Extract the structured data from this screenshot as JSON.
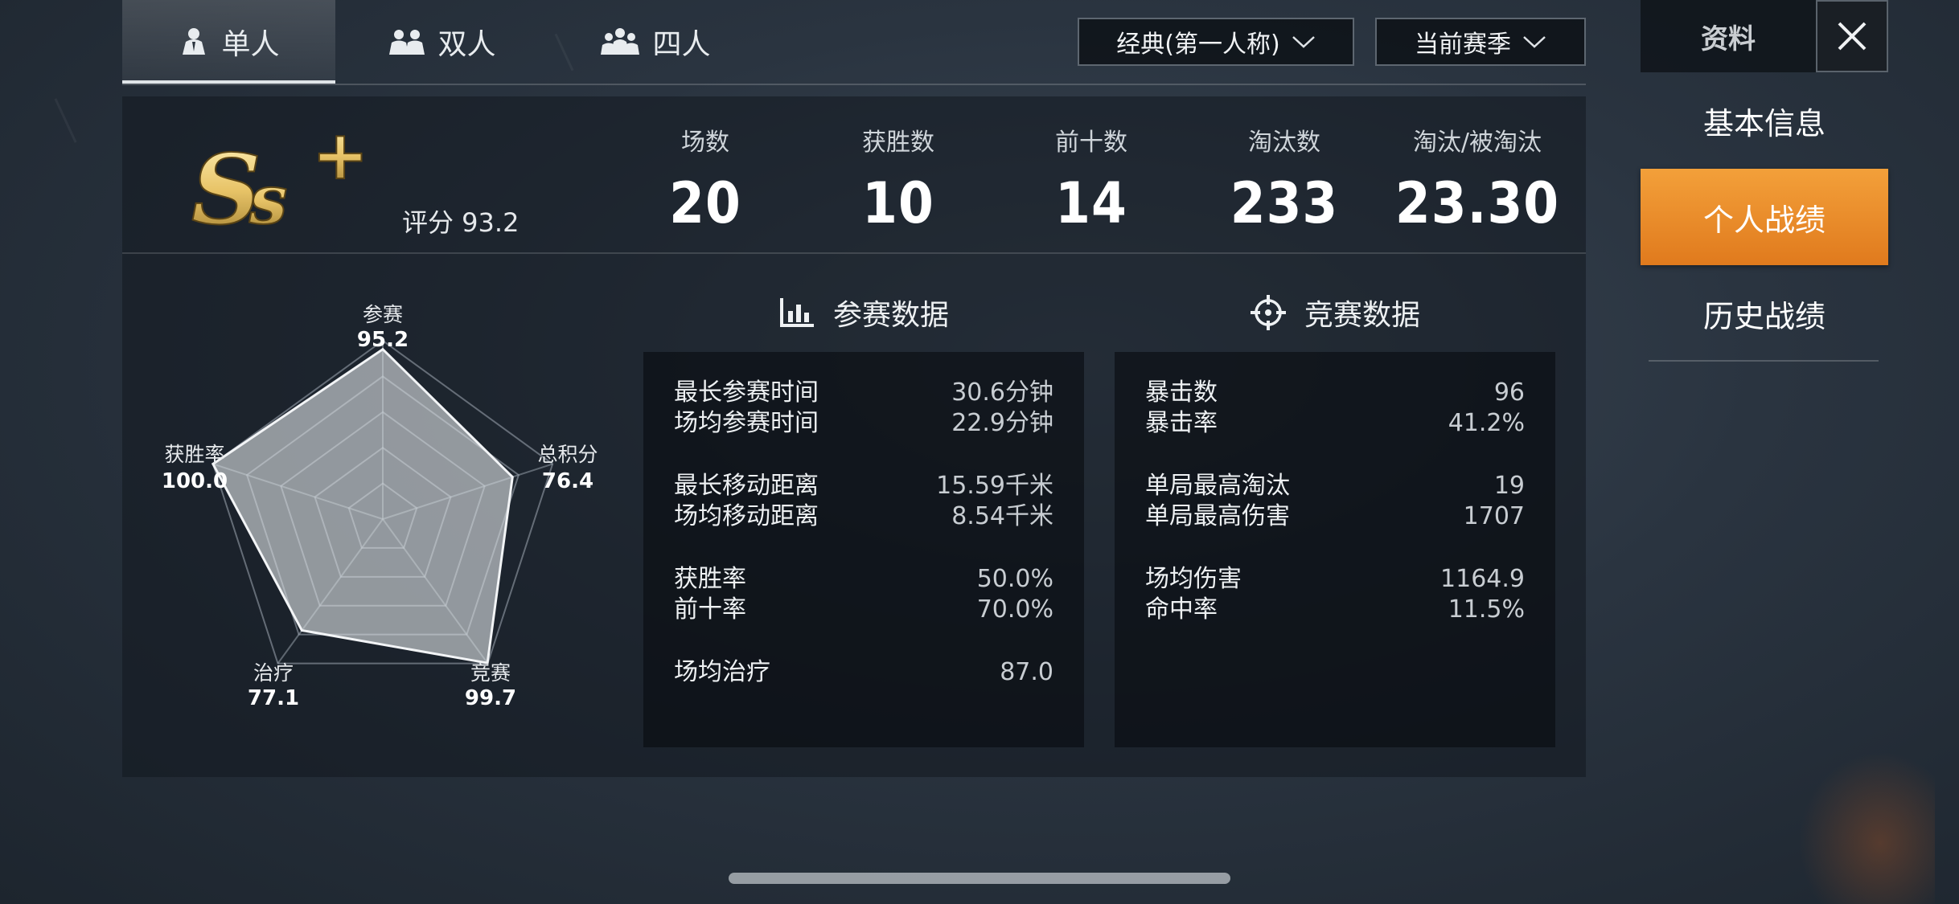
{
  "tabs": [
    {
      "label": "单人",
      "icon": "single-player-icon",
      "active": true
    },
    {
      "label": "双人",
      "icon": "duo-players-icon",
      "active": false
    },
    {
      "label": "四人",
      "icon": "squad-players-icon",
      "active": false
    }
  ],
  "filters": {
    "mode": "经典(第一人称)",
    "season": "当前赛季"
  },
  "summary": {
    "rank": "Ss+",
    "rank_color": "#e8c468",
    "score_label": "评分 93.2",
    "stats": [
      {
        "label": "场数",
        "value": "20"
      },
      {
        "label": "获胜数",
        "value": "10"
      },
      {
        "label": "前十数",
        "value": "14"
      },
      {
        "label": "淘汰数",
        "value": "233"
      },
      {
        "label": "淘汰/被淘汰",
        "value": "23.30"
      }
    ]
  },
  "radar": {
    "axes": [
      {
        "label": "参赛",
        "value": "95.2",
        "score": 95.2
      },
      {
        "label": "总积分",
        "value": "76.4",
        "score": 76.4
      },
      {
        "label": "竞赛",
        "value": "99.7",
        "score": 99.7
      },
      {
        "label": "治疗",
        "value": "77.1",
        "score": 77.1
      },
      {
        "label": "获胜率",
        "value": "100.0",
        "score": 100.0
      }
    ]
  },
  "participation": {
    "title": "参赛数据",
    "icon": "bar-chart-icon",
    "rows": [
      {
        "key": "最长参赛时间",
        "value": "30.6分钟"
      },
      {
        "key": "场均参赛时间",
        "value": "22.9分钟"
      },
      {
        "key": "最长移动距离",
        "value": "15.59千米"
      },
      {
        "key": "场均移动距离",
        "value": "8.54千米"
      },
      {
        "key": "获胜率",
        "value": "50.0%"
      },
      {
        "key": "前十率",
        "value": "70.0%"
      },
      {
        "key": "场均治疗",
        "value": "87.0"
      }
    ]
  },
  "combat": {
    "title": "竞赛数据",
    "icon": "crosshair-icon",
    "rows": [
      {
        "key": "暴击数",
        "value": "96"
      },
      {
        "key": "暴击率",
        "value": "41.2%"
      },
      {
        "key": "单局最高淘汰",
        "value": "19"
      },
      {
        "key": "单局最高伤害",
        "value": "1707"
      },
      {
        "key": "场均伤害",
        "value": "1164.9"
      },
      {
        "key": "命中率",
        "value": "11.5%"
      }
    ]
  },
  "sidebar": {
    "title": "资料",
    "items": [
      {
        "label": "基本信息",
        "active": false
      },
      {
        "label": "个人战绩",
        "active": true
      },
      {
        "label": "历史战绩",
        "active": false
      }
    ],
    "active_color": "#ee8a2a"
  }
}
